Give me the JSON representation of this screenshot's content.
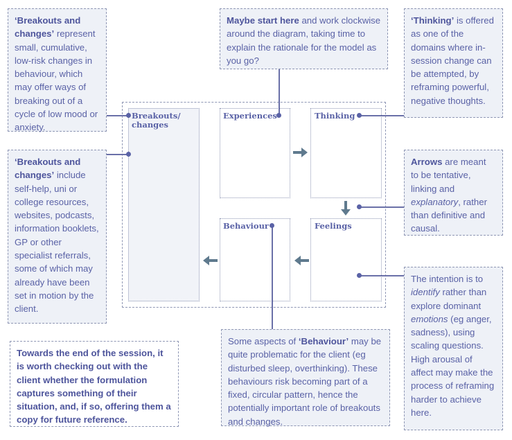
{
  "notes": {
    "breakouts_represent": {
      "bold": "‘Breakouts and changes’",
      "text": " represent small, cumulative, low-risk changes in behaviour, which may offer ways of breaking out of a cycle of low mood or anxiety."
    },
    "start_here": {
      "bold": "Maybe start here",
      "text": " and work clockwise around the diagram, taking time to explain the rationale for the model as you go?"
    },
    "thinking": {
      "bold": "‘Thinking’",
      "text": " is offered as one of the domains where in-session change can be attempted, by reframing powerful, negative thoughts."
    },
    "breakouts_include": {
      "bold": "‘Breakouts and changes’",
      "text": " include self-help, uni or college resources, websites, podcasts, information booklets, GP or other specialist referrals, some of which may already have been set in motion by the client."
    },
    "arrows": {
      "bold": "Arrows",
      "text1": " are meant to be tentative, linking and ",
      "italic": "explanatory",
      "text2": ", rather than definitive and causal."
    },
    "feelings": {
      "text1": "The intention is to ",
      "italic1": "identify",
      "text2": " rather than explore dominant ",
      "italic2": "emotions",
      "text3": " (eg anger, sadness), using scaling questions. High arousal of affect may make the process of reframing harder to achieve here."
    },
    "behaviour": {
      "text1": "Some aspects of ",
      "bold": "‘Behaviour’",
      "text2": " may be quite problematic for the client (eg disturbed sleep, overthinking). These behaviours risk becoming part of a fixed, circular pattern, hence the potentially important role of breakouts and changes."
    },
    "end_session": {
      "text": "Towards the end of the session, it is worth checking out with the client whether the formulation captures something of their situation, and, if so, offering them a copy for future reference."
    }
  },
  "diagram": {
    "boxes": {
      "breakouts": "Breakouts/ changes",
      "experiences": "Experiences",
      "thinking": "Thinking",
      "feelings": "Feelings",
      "behaviour": "Behaviour"
    },
    "arrows": [
      {
        "from": "Experiences",
        "to": "Thinking",
        "direction": "right"
      },
      {
        "from": "Thinking",
        "to": "Feelings",
        "direction": "down"
      },
      {
        "from": "Feelings",
        "to": "Behaviour",
        "direction": "left"
      },
      {
        "from": "Behaviour",
        "to": "Breakouts/ changes",
        "direction": "left"
      }
    ],
    "colors": {
      "text": "#5a62a6",
      "arrow": "#5f7a8e",
      "note_bg": "#eef1f7",
      "border": "#8e96b4"
    }
  }
}
